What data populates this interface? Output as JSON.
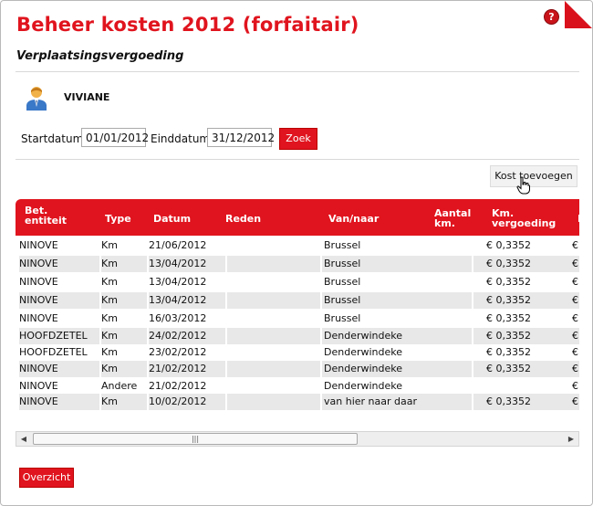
{
  "header": {
    "title": "Beheer kosten 2012 (forfaitair)",
    "help_icon": "?",
    "subtitle": "Verplaatsingsvergoeding"
  },
  "user": {
    "name": "VIVIANE"
  },
  "search": {
    "start_label": "Startdatum",
    "start_value": "01/01/2012",
    "end_label": "Einddatum",
    "end_value": "31/12/2012",
    "button_label": "Zoek"
  },
  "actions": {
    "add_cost_label": "Kost toevoegen"
  },
  "table": {
    "headers": {
      "entiteit_line1": "Bet.",
      "entiteit_line2": "entiteit",
      "type": "Type",
      "datum": "Datum",
      "reden": "Reden",
      "van_naar": "Van/naar",
      "aantal_line1": "Aantal",
      "aantal_line2": "km.",
      "km_line1": "Km.",
      "km_line2": "vergoeding",
      "extra": "E"
    },
    "rows": [
      {
        "entiteit": "NINOVE",
        "type": "Km",
        "datum": "21/06/2012",
        "reden": "",
        "van_naar": "Brussel",
        "aantal": "",
        "vergoeding": "€ 0,3352",
        "extra": "€"
      },
      {
        "entiteit": "NINOVE",
        "type": "Km",
        "datum": "13/04/2012",
        "reden": "",
        "van_naar": "Brussel",
        "aantal": "",
        "vergoeding": "€ 0,3352",
        "extra": "€"
      },
      {
        "entiteit": "NINOVE",
        "type": "Km",
        "datum": "13/04/2012",
        "reden": "",
        "van_naar": "Brussel",
        "aantal": "",
        "vergoeding": "€ 0,3352",
        "extra": "€"
      },
      {
        "entiteit": "NINOVE",
        "type": "Km",
        "datum": "13/04/2012",
        "reden": "",
        "van_naar": "Brussel",
        "aantal": "",
        "vergoeding": "€ 0,3352",
        "extra": "€"
      },
      {
        "entiteit": "NINOVE",
        "type": "Km",
        "datum": "16/03/2012",
        "reden": "",
        "van_naar": "Brussel",
        "aantal": "",
        "vergoeding": "€ 0,3352",
        "extra": "€"
      },
      {
        "entiteit": "HOOFDZETEL",
        "type": "Km",
        "datum": "24/02/2012",
        "reden": "",
        "van_naar": "Denderwindeke",
        "aantal": "",
        "vergoeding": "€ 0,3352",
        "extra": "€"
      },
      {
        "entiteit": "HOOFDZETEL",
        "type": "Km",
        "datum": "23/02/2012",
        "reden": "",
        "van_naar": "Denderwindeke",
        "aantal": "",
        "vergoeding": "€ 0,3352",
        "extra": "€"
      },
      {
        "entiteit": "NINOVE",
        "type": "Km",
        "datum": "21/02/2012",
        "reden": "",
        "van_naar": "Denderwindeke",
        "aantal": "",
        "vergoeding": "€ 0,3352",
        "extra": "€"
      },
      {
        "entiteit": "NINOVE",
        "type": "Andere",
        "datum": "21/02/2012",
        "reden": "",
        "van_naar": "Denderwindeke",
        "aantal": "",
        "vergoeding": "",
        "extra": "€"
      },
      {
        "entiteit": "NINOVE",
        "type": "Km",
        "datum": "10/02/2012",
        "reden": "",
        "van_naar": "van hier naar daar",
        "aantal": "",
        "vergoeding": "€ 0,3352",
        "extra": "€"
      }
    ]
  },
  "footer": {
    "overview_label": "Overzicht"
  },
  "colors": {
    "accent": "#e0141e",
    "row_shade": "#e8e8e8"
  }
}
